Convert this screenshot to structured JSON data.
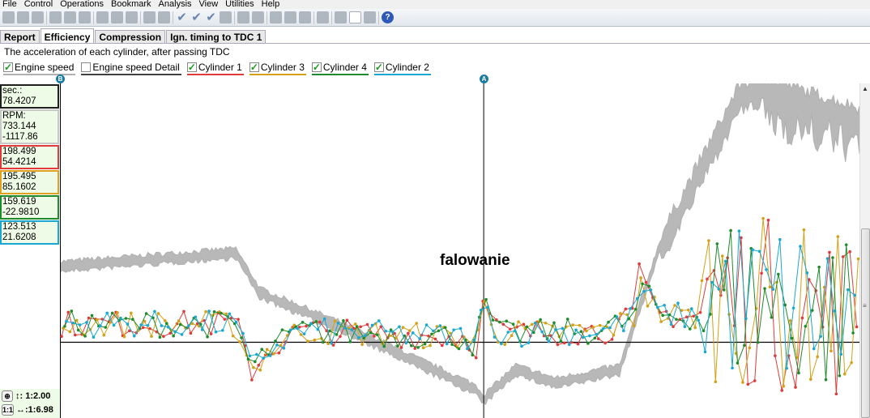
{
  "menu": [
    "File",
    "Control",
    "Operations",
    "Bookmark",
    "Analysis",
    "View",
    "Utilities",
    "Help"
  ],
  "tabs": [
    {
      "label": "Report"
    },
    {
      "label": "Efficiency",
      "active": true
    },
    {
      "label": "Compression"
    },
    {
      "label": "Ign. timing to TDC 1"
    }
  ],
  "subtitle": "The acceleration of each cylinder, after passing TDC",
  "legend": [
    {
      "label": "Engine speed",
      "checked": true,
      "color": "#b0b0b0"
    },
    {
      "label": "Engine speed Detail",
      "checked": false,
      "color": "#404040"
    },
    {
      "label": "Cylinder 1",
      "checked": true,
      "color": "#e03a3a"
    },
    {
      "label": "Cylinder 3",
      "checked": true,
      "color": "#d4a017"
    },
    {
      "label": "Cylinder 4",
      "checked": true,
      "color": "#1e8c2a"
    },
    {
      "label": "Cylinder 2",
      "checked": true,
      "color": "#1aa8d0"
    }
  ],
  "readouts": [
    {
      "lines": [
        "sec.:",
        "78.4207"
      ],
      "color": "#202020"
    },
    {
      "lines": [
        "RPM:",
        "733.144",
        "-1117.86"
      ],
      "color": "#c8c8c8"
    },
    {
      "lines": [
        "198.499",
        "54.4214"
      ],
      "color": "#e03a3a"
    },
    {
      "lines": [
        "195.495",
        "85.1602"
      ],
      "color": "#e0a020"
    },
    {
      "lines": [
        "159.619",
        "-22.9810"
      ],
      "color": "#1e8c2a"
    },
    {
      "lines": [
        "123.513",
        "21.6208"
      ],
      "color": "#1aa8d0"
    }
  ],
  "cursors": {
    "a": "A",
    "b": "B"
  },
  "zoom": {
    "vertical": "↕: 1:2.00",
    "horizontal": "↔:1:6.98",
    "fit_label": "1:1"
  },
  "annotation": "falowanie",
  "chart_data": {
    "type": "line",
    "x_range": [
      0,
      100
    ],
    "y_range": [
      0,
      100
    ],
    "zero_level": 22.5,
    "cursor_b_x": 0,
    "cursor_a_x": 53,
    "engine_speed": [
      [
        0,
        46
      ],
      [
        22,
        50
      ],
      [
        25,
        38
      ],
      [
        35,
        28
      ],
      [
        52,
        9
      ],
      [
        53,
        6
      ],
      [
        57,
        15
      ],
      [
        62,
        11
      ],
      [
        70,
        15
      ],
      [
        75,
        52
      ],
      [
        85,
        98
      ],
      [
        88,
        100
      ],
      [
        100,
        91
      ]
    ],
    "cylinder_baseline": [
      [
        0,
        28
      ],
      [
        22,
        28
      ],
      [
        24,
        14
      ],
      [
        26,
        20
      ],
      [
        30,
        26
      ],
      [
        51,
        24
      ],
      [
        52,
        21
      ],
      [
        53,
        34
      ],
      [
        55,
        25
      ],
      [
        68,
        26
      ],
      [
        72,
        30
      ],
      [
        72.5,
        45
      ],
      [
        73,
        38
      ],
      [
        75,
        31
      ],
      [
        80,
        30
      ],
      [
        81,
        37
      ],
      [
        100,
        30
      ]
    ],
    "noise_start_large": 80
  }
}
